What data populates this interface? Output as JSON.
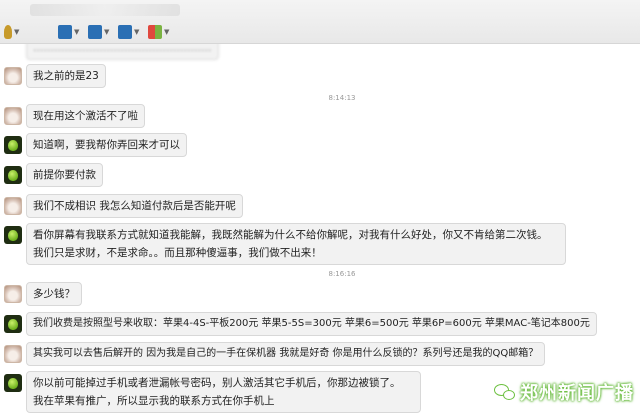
{
  "toolbar": {
    "buttons": [
      {
        "icon": "microphone-icon",
        "color": "#c79a2a"
      },
      {
        "icon": "emoticon-icon",
        "color": "#2a6fb4"
      },
      {
        "icon": "screen-share-icon",
        "color": "#2a6fb4"
      },
      {
        "icon": "transfer-icon",
        "color": "#2a6fb4"
      },
      {
        "icon": "app-grid-icon",
        "color": "#7bb342"
      }
    ]
  },
  "messages": [
    {
      "avatar": "rabbit",
      "text": "我之前的是23"
    },
    {
      "time": "8:14:13"
    },
    {
      "avatar": "rabbit",
      "text": "现在用这个激活不了啦"
    },
    {
      "avatar": "apple",
      "text": "知道啊，要我帮你弄回来才可以"
    },
    {
      "avatar": "apple",
      "text": "前提你要付款"
    },
    {
      "avatar": "rabbit",
      "text": "我们不成相识 我怎么知道付款后是否能开呢"
    },
    {
      "avatar": "apple",
      "text": "看你屏幕有我联系方式就知道我能解，我既然能解为什么不给你解呢，对我有什么好处，你又不肯给第二次钱。"
    },
    {
      "avatar": null,
      "text": "我们只是求财，不是求命。。而且那种傻逼事，我们做不出来！"
    },
    {
      "time": "8:16:16"
    },
    {
      "avatar": "rabbit",
      "text": "多少钱？"
    },
    {
      "avatar": "apple",
      "text": "我们收费是按照型号来收取：苹果4-4S-平板200元 苹果5-5S=300元 苹果6=500元 苹果6P=600元 苹果MAC-笔记本800元"
    },
    {
      "avatar": "rabbit",
      "text": "其实我可以去售后解开的 因为我是自己的一手在保机器  我就是好奇 你是用什么反锁的？系列号还是我的QQ邮箱？"
    },
    {
      "avatar": "apple",
      "text": "你以前可能掉过手机或者泄漏帐号密码，别人激活其它手机后，你那边被锁了。"
    },
    {
      "avatar": null,
      "text": "我在苹果有推广，所以显示我的联系方式在你手机上"
    }
  ],
  "watermark": {
    "text": "郑州新闻广播",
    "icon": "wechat-icon",
    "color": "#6ec142"
  }
}
